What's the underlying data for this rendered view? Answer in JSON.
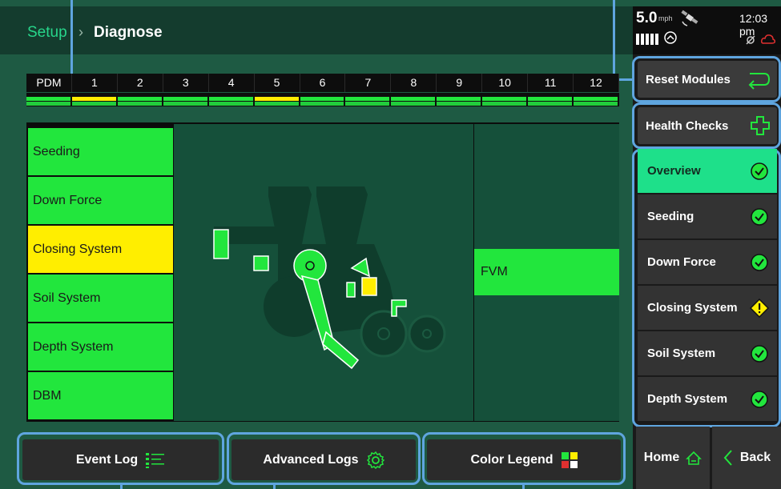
{
  "breadcrumb": {
    "parent": "Setup",
    "separator": "›",
    "current": "Diagnose"
  },
  "status": {
    "speed": "5.0",
    "speed_unit": "mph",
    "time": "12:03 pm"
  },
  "pdm": {
    "cells": [
      "PDM",
      "1",
      "2",
      "3",
      "4",
      "5",
      "6",
      "7",
      "8",
      "9",
      "10",
      "11",
      "12"
    ],
    "top_status": [
      "green",
      "yellow",
      "green",
      "green",
      "green",
      "yellow",
      "green",
      "green",
      "green",
      "green",
      "green",
      "green",
      "green"
    ]
  },
  "systems": [
    "Seeding",
    "Down Force",
    "Closing System",
    "Soil System",
    "Depth System",
    "DBM"
  ],
  "fvm_label": "FVM",
  "bottom_buttons": {
    "event_log": "Event Log",
    "advanced_logs": "Advanced Logs",
    "color_legend": "Color Legend"
  },
  "side": {
    "reset_modules": "Reset Modules",
    "health_checks": "Health Checks",
    "nav": [
      {
        "label": "Overview",
        "status": "ok"
      },
      {
        "label": "Seeding",
        "status": "ok"
      },
      {
        "label": "Down Force",
        "status": "ok"
      },
      {
        "label": "Closing System",
        "status": "warning"
      },
      {
        "label": "Soil System",
        "status": "ok"
      },
      {
        "label": "Depth System",
        "status": "ok"
      }
    ],
    "home": "Home",
    "back": "Back"
  },
  "colors": {
    "ok_green": "#22e63d",
    "warning_yellow": "#ffee00",
    "accent": "#1ee08a",
    "callout_blue": "#5fa5df"
  }
}
